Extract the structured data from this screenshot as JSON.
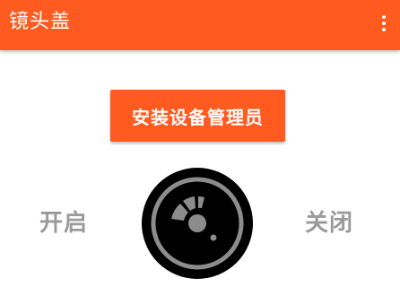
{
  "app": {
    "title": "镜头盖",
    "colors": {
      "accent": "#FF5A1F",
      "text_on_accent": "#FFFFFF",
      "muted_label": "#9A9A9A",
      "lens_body": "#000000",
      "lens_ring": "#8C8C8C"
    }
  },
  "toolbar": {
    "overflow_icon": "more-vert-icon"
  },
  "main": {
    "install_button_label": "安装设备管理员",
    "toggle_on_label": "开启",
    "toggle_off_label": "关闭",
    "lens_icon": "camera-lens-icon"
  }
}
